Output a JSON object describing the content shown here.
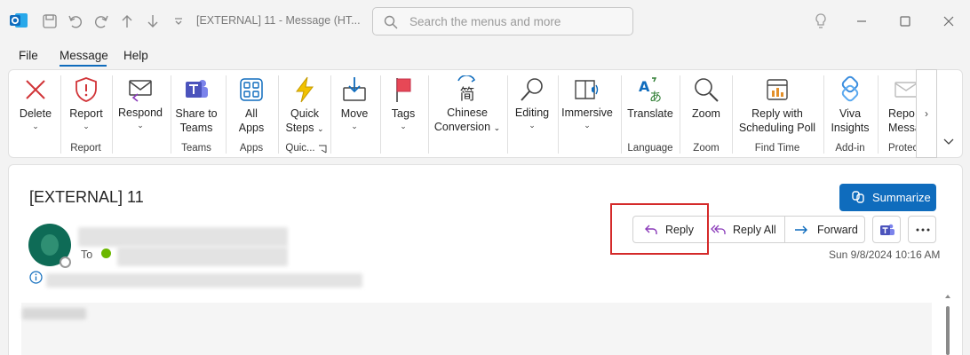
{
  "titlebar": {
    "title": "[EXTERNAL] 11  -  Message (HT...",
    "search_placeholder": "Search the menus and more"
  },
  "menu": {
    "tabs": [
      {
        "label": "File"
      },
      {
        "label": "Message",
        "active": true
      },
      {
        "label": "Help"
      }
    ]
  },
  "ribbon": {
    "buttons": {
      "delete": "Delete",
      "report": "Report",
      "respond": "Respond",
      "share_to_teams_1": "Share to",
      "share_to_teams_2": "Teams",
      "all_apps_1": "All",
      "all_apps_2": "Apps",
      "quick_steps_1": "Quick",
      "quick_steps_2": "Steps",
      "move": "Move",
      "tags": "Tags",
      "chinese_conversion_1": "Chinese",
      "chinese_conversion_2": "Conversion",
      "editing": "Editing",
      "immersive": "Immersive",
      "translate": "Translate",
      "zoom": "Zoom",
      "reply_sched_1": "Reply with",
      "reply_sched_2": "Scheduling Poll",
      "viva_1": "Viva",
      "viva_2": "Insights",
      "report_msg_1": "Repo",
      "report_msg_2": "Messa"
    },
    "groups": {
      "report": "Report",
      "teams": "Teams",
      "apps": "Apps",
      "quick": "Quic...",
      "language": "Language",
      "zoom": "Zoom",
      "find_time": "Find Time",
      "addin": "Add-in",
      "protect": "Protec"
    }
  },
  "message": {
    "subject": "[EXTERNAL] 11",
    "to_label": "To",
    "summarize_label": "Summarize",
    "timestamp": "Sun 9/8/2024 10:16 AM",
    "actions": {
      "reply": "Reply",
      "reply_all": "Reply All",
      "forward": "Forward"
    }
  },
  "colors": {
    "accent": "#0f6cbd",
    "highlight": "#d42a2a",
    "avatar": "#0e6b56"
  }
}
